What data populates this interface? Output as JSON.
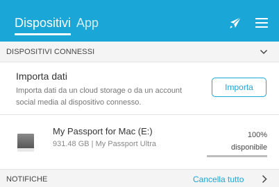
{
  "header": {
    "tabs": [
      {
        "label": "Dispositivi",
        "active": true
      },
      {
        "label": "App",
        "active": false
      }
    ],
    "icons": [
      "rocket-icon",
      "menu-icon"
    ],
    "accent_color": "#1aa6d6"
  },
  "connected_section": {
    "label": "DISPOSITIVI CONNESSI",
    "icon": "chevron-down-icon"
  },
  "import_card": {
    "title": "Importa dati",
    "description": "Importa dati da un cloud storage o da un account social media al dispositivo connesso.",
    "button_label": "Importa"
  },
  "device": {
    "name": "My Passport for Mac (E:)",
    "info": "931.48 GB | My Passport Ultra",
    "available_percent": "100%",
    "available_label": "disponibile",
    "available_fraction": 1.0,
    "icon": "hard-drive-icon"
  },
  "notifications": {
    "label": "NOTIFICHE",
    "clear_all": "Cancella tutto",
    "icon": "chevron-right-icon"
  }
}
